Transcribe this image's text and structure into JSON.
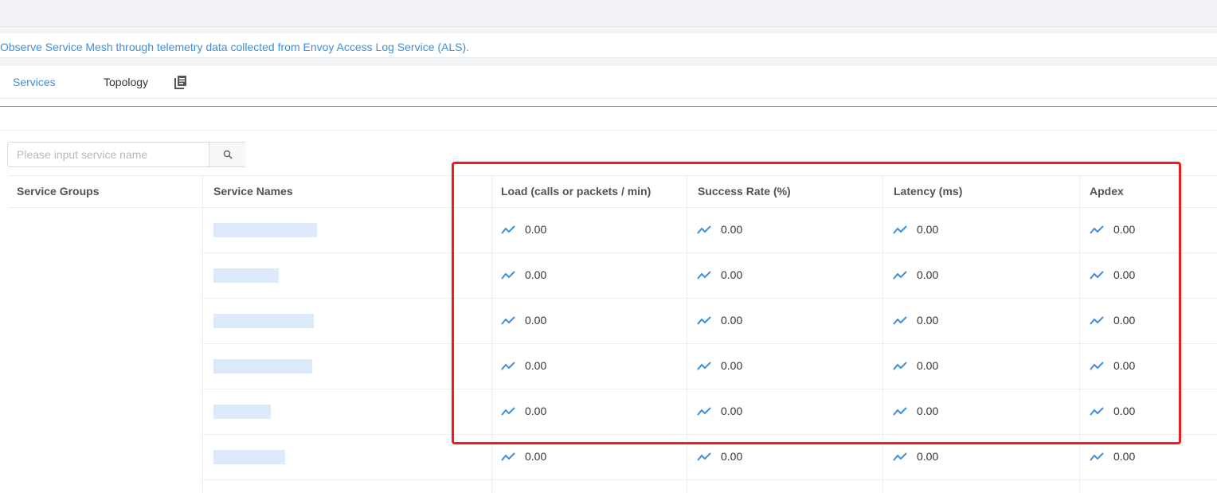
{
  "description": "Observe Service Mesh through telemetry data collected from Envoy Access Log Service (ALS).",
  "tabs": [
    {
      "label": "Services"
    },
    {
      "label": "Topology"
    }
  ],
  "search": {
    "placeholder": "Please input service name",
    "value": ""
  },
  "table": {
    "headers": [
      "Service Groups",
      "Service Names",
      "Load (calls or packets / min)",
      "Success Rate (%)",
      "Latency (ms)",
      "Apdex"
    ],
    "rows": [
      {
        "service": "",
        "load": "0.00",
        "success": "0.00",
        "latency": "0.00",
        "apdex": "0.00"
      },
      {
        "service": "",
        "load": "0.00",
        "success": "0.00",
        "latency": "0.00",
        "apdex": "0.00"
      },
      {
        "service": "",
        "load": "0.00",
        "success": "0.00",
        "latency": "0.00",
        "apdex": "0.00"
      },
      {
        "service": "",
        "load": "0.00",
        "success": "0.00",
        "latency": "0.00",
        "apdex": "0.00"
      },
      {
        "service": "",
        "load": "0.00",
        "success": "0.00",
        "latency": "0.00",
        "apdex": "0.00"
      },
      {
        "service": "",
        "load": "0.00",
        "success": "0.00",
        "latency": "0.00",
        "apdex": "0.00"
      }
    ]
  },
  "colors": {
    "accent": "#3d8fdc",
    "highlight": "#ee1c1c"
  },
  "icons": {
    "trend": "trend-line-icon",
    "search": "search-icon",
    "doc": "document-copy-icon"
  }
}
